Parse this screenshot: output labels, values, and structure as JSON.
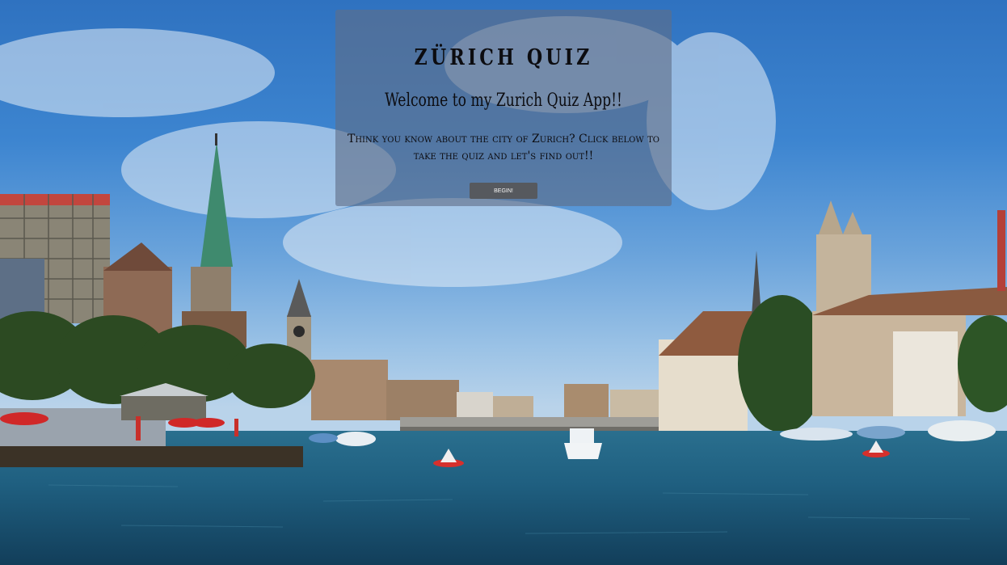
{
  "quiz": {
    "title": "ZÜRICH QUIZ",
    "welcome": "Welcome to my Zurich Quiz App!!",
    "intro": "Think you know about the city of Zurich? Click below to take the quiz and let's find out!!",
    "begin_label": "BEGIN!"
  },
  "colors": {
    "sky": "#3d85d0",
    "water": "#1d5a7c",
    "card_overlay": "#5f6e87",
    "button": "#56595e"
  }
}
